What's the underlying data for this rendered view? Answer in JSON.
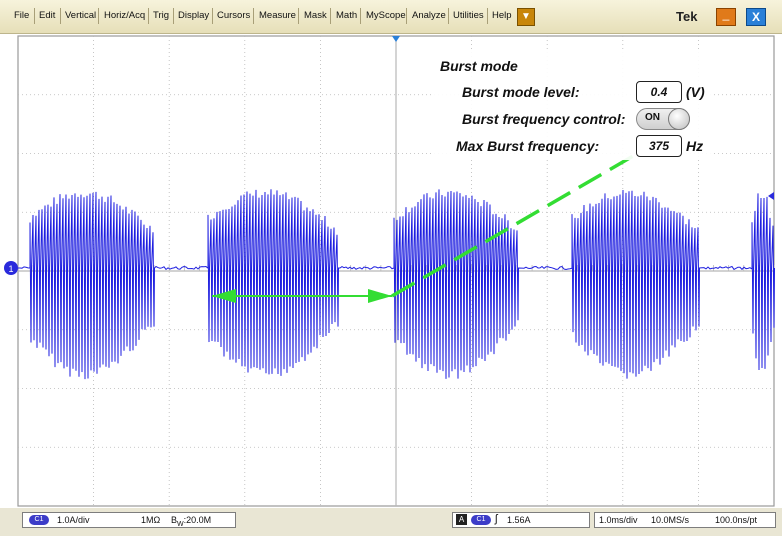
{
  "menu": {
    "items": [
      "File",
      "Edit",
      "Vertical",
      "Horiz/Acq",
      "Trig",
      "Display",
      "Cursors",
      "Measure",
      "Mask",
      "Math",
      "MyScope",
      "Analyze",
      "Utilities",
      "Help"
    ],
    "brand": "Tek",
    "dropdown_icon": "triangle-down-icon",
    "minimize_label": "_",
    "close_label": "X"
  },
  "burst_panel": {
    "title": "Burst mode",
    "level_label": "Burst mode level:",
    "level_value": "0.4",
    "level_unit": "(V)",
    "freq_control_label": "Burst frequency control:",
    "freq_control_state": "ON",
    "max_freq_label": "Max Burst frequency:",
    "max_freq_value": "375",
    "max_freq_unit": "Hz"
  },
  "channel_marker": "1",
  "status": {
    "ch_badge": "C1",
    "scale": "1.0A/div",
    "impedance": "1MΩ",
    "bw_prefix": "B",
    "bw_sub": "W",
    "bw_value": ":20.0M",
    "trig_badge": "A",
    "trig_ch": "C1",
    "trig_level": "1.56A",
    "timebase": "1.0ms/div",
    "sample_rate": "10.0MS/s",
    "resolution": "100.0ns/pt"
  },
  "colors": {
    "trace": "#1f1fe0",
    "annotation": "#33dd33",
    "grid": "#b8b8b8"
  }
}
